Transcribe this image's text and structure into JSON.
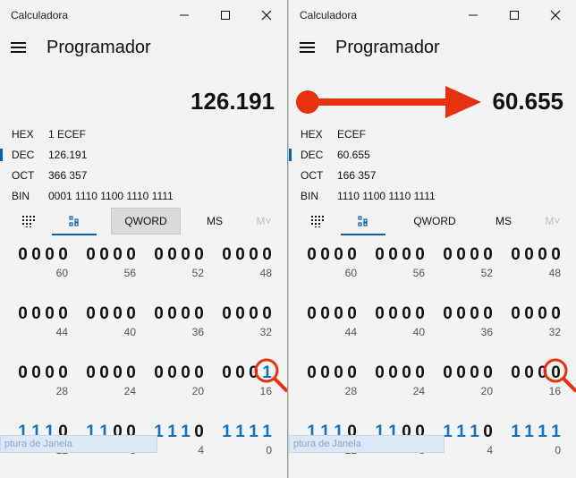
{
  "left": {
    "title": "Calculadora",
    "mode": "Programador",
    "display": "126.191",
    "radix": [
      {
        "label": "HEX",
        "value": "1 ECEF"
      },
      {
        "label": "DEC",
        "value": "126.191"
      },
      {
        "label": "OCT",
        "value": "366 357"
      },
      {
        "label": "BIN",
        "value": "0001 1110 1100 1110 1111"
      }
    ],
    "tools": {
      "word": "QWORD",
      "ms": "MS",
      "mv": "M˅"
    },
    "rows": [
      {
        "groups": [
          {
            "bits": "0000",
            "pos": "60"
          },
          {
            "bits": "0000",
            "pos": "56"
          },
          {
            "bits": "0000",
            "pos": "52"
          },
          {
            "bits": "0000",
            "pos": "48"
          }
        ]
      },
      {
        "groups": [
          {
            "bits": "0000",
            "pos": "44"
          },
          {
            "bits": "0000",
            "pos": "40"
          },
          {
            "bits": "0000",
            "pos": "36"
          },
          {
            "bits": "0000",
            "pos": "32"
          }
        ]
      },
      {
        "groups": [
          {
            "bits": "0000",
            "pos": "28"
          },
          {
            "bits": "0000",
            "pos": "24"
          },
          {
            "bits": "0000",
            "pos": "20"
          },
          {
            "bits": "0001",
            "pos": "16"
          }
        ]
      },
      {
        "groups": [
          {
            "bits": "1110",
            "pos": "12"
          },
          {
            "bits": "1100",
            "pos": "8"
          },
          {
            "bits": "1110",
            "pos": "4"
          },
          {
            "bits": "1111",
            "pos": "0"
          }
        ]
      }
    ],
    "ghost": "ptura de Janela"
  },
  "right": {
    "title": "Calculadora",
    "mode": "Programador",
    "display": "60.655",
    "radix": [
      {
        "label": "HEX",
        "value": "ECEF"
      },
      {
        "label": "DEC",
        "value": "60.655"
      },
      {
        "label": "OCT",
        "value": "166 357"
      },
      {
        "label": "BIN",
        "value": "1110 1100 1110 1111"
      }
    ],
    "tools": {
      "word": "QWORD",
      "ms": "MS",
      "mv": "M˅"
    },
    "rows": [
      {
        "groups": [
          {
            "bits": "0000",
            "pos": "60"
          },
          {
            "bits": "0000",
            "pos": "56"
          },
          {
            "bits": "0000",
            "pos": "52"
          },
          {
            "bits": "0000",
            "pos": "48"
          }
        ]
      },
      {
        "groups": [
          {
            "bits": "0000",
            "pos": "44"
          },
          {
            "bits": "0000",
            "pos": "40"
          },
          {
            "bits": "0000",
            "pos": "36"
          },
          {
            "bits": "0000",
            "pos": "32"
          }
        ]
      },
      {
        "groups": [
          {
            "bits": "0000",
            "pos": "28"
          },
          {
            "bits": "0000",
            "pos": "24"
          },
          {
            "bits": "0000",
            "pos": "20"
          },
          {
            "bits": "0000",
            "pos": "16"
          }
        ]
      },
      {
        "groups": [
          {
            "bits": "1110",
            "pos": "12"
          },
          {
            "bits": "1100",
            "pos": "8"
          },
          {
            "bits": "1110",
            "pos": "4"
          },
          {
            "bits": "1111",
            "pos": "0"
          }
        ]
      }
    ],
    "ghost": "ptura de Janela"
  },
  "colors": {
    "accent": "#0063b1",
    "bit_on": "#0e73c5",
    "annotation": "#e8320f"
  },
  "icons": [
    "menu-icon",
    "keypad-icon",
    "bit-toggle-icon",
    "minimize-icon",
    "maximize-icon",
    "close-icon",
    "magnifier-icon",
    "arrow-icon"
  ]
}
